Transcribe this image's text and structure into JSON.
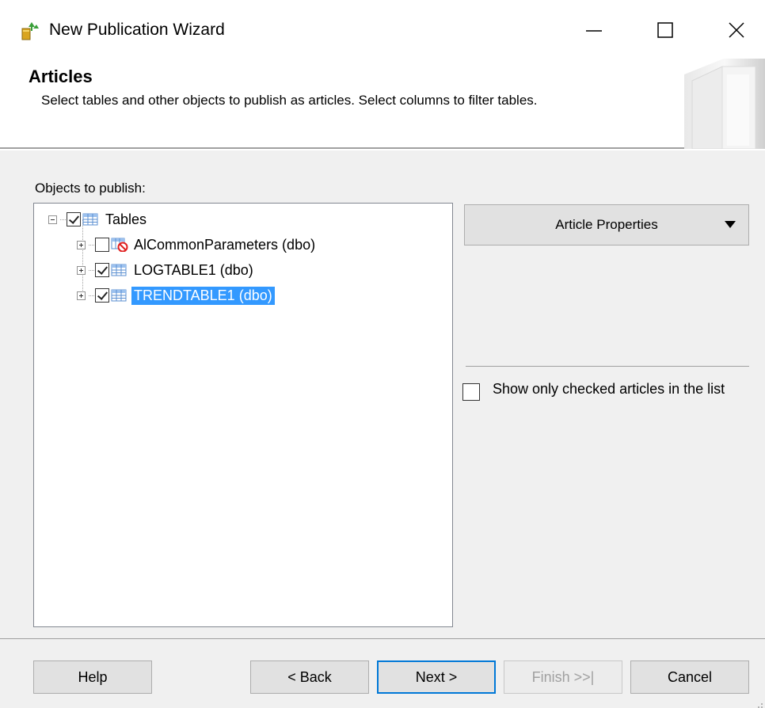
{
  "window": {
    "title": "New Publication Wizard",
    "icon": "wizard-icon"
  },
  "header": {
    "title": "Articles",
    "description": "Select tables and other objects to publish as articles. Select columns to filter tables."
  },
  "tree": {
    "label": "Objects to publish:",
    "root": {
      "label": "Tables",
      "checked": true,
      "expanded": true
    },
    "items": [
      {
        "label": "AlCommonParameters (dbo)",
        "checked": false,
        "icon": "table-excluded-icon",
        "selected": false
      },
      {
        "label": "LOGTABLE1 (dbo)",
        "checked": true,
        "icon": "table-icon",
        "selected": false
      },
      {
        "label": "TRENDTABLE1 (dbo)",
        "checked": true,
        "icon": "table-icon",
        "selected": true
      }
    ]
  },
  "article_properties": {
    "label": "Article Properties"
  },
  "show_only_checked": {
    "label": "Show only checked articles in the list",
    "checked": false
  },
  "buttons": {
    "help": "Help",
    "back": "< Back",
    "next": "Next >",
    "finish": "Finish >>|",
    "cancel": "Cancel"
  },
  "colors": {
    "selection": "#3399ff",
    "dialog_bg": "#f0f0f0",
    "button_bg": "#e1e1e1",
    "focus_border": "#0078d7"
  }
}
